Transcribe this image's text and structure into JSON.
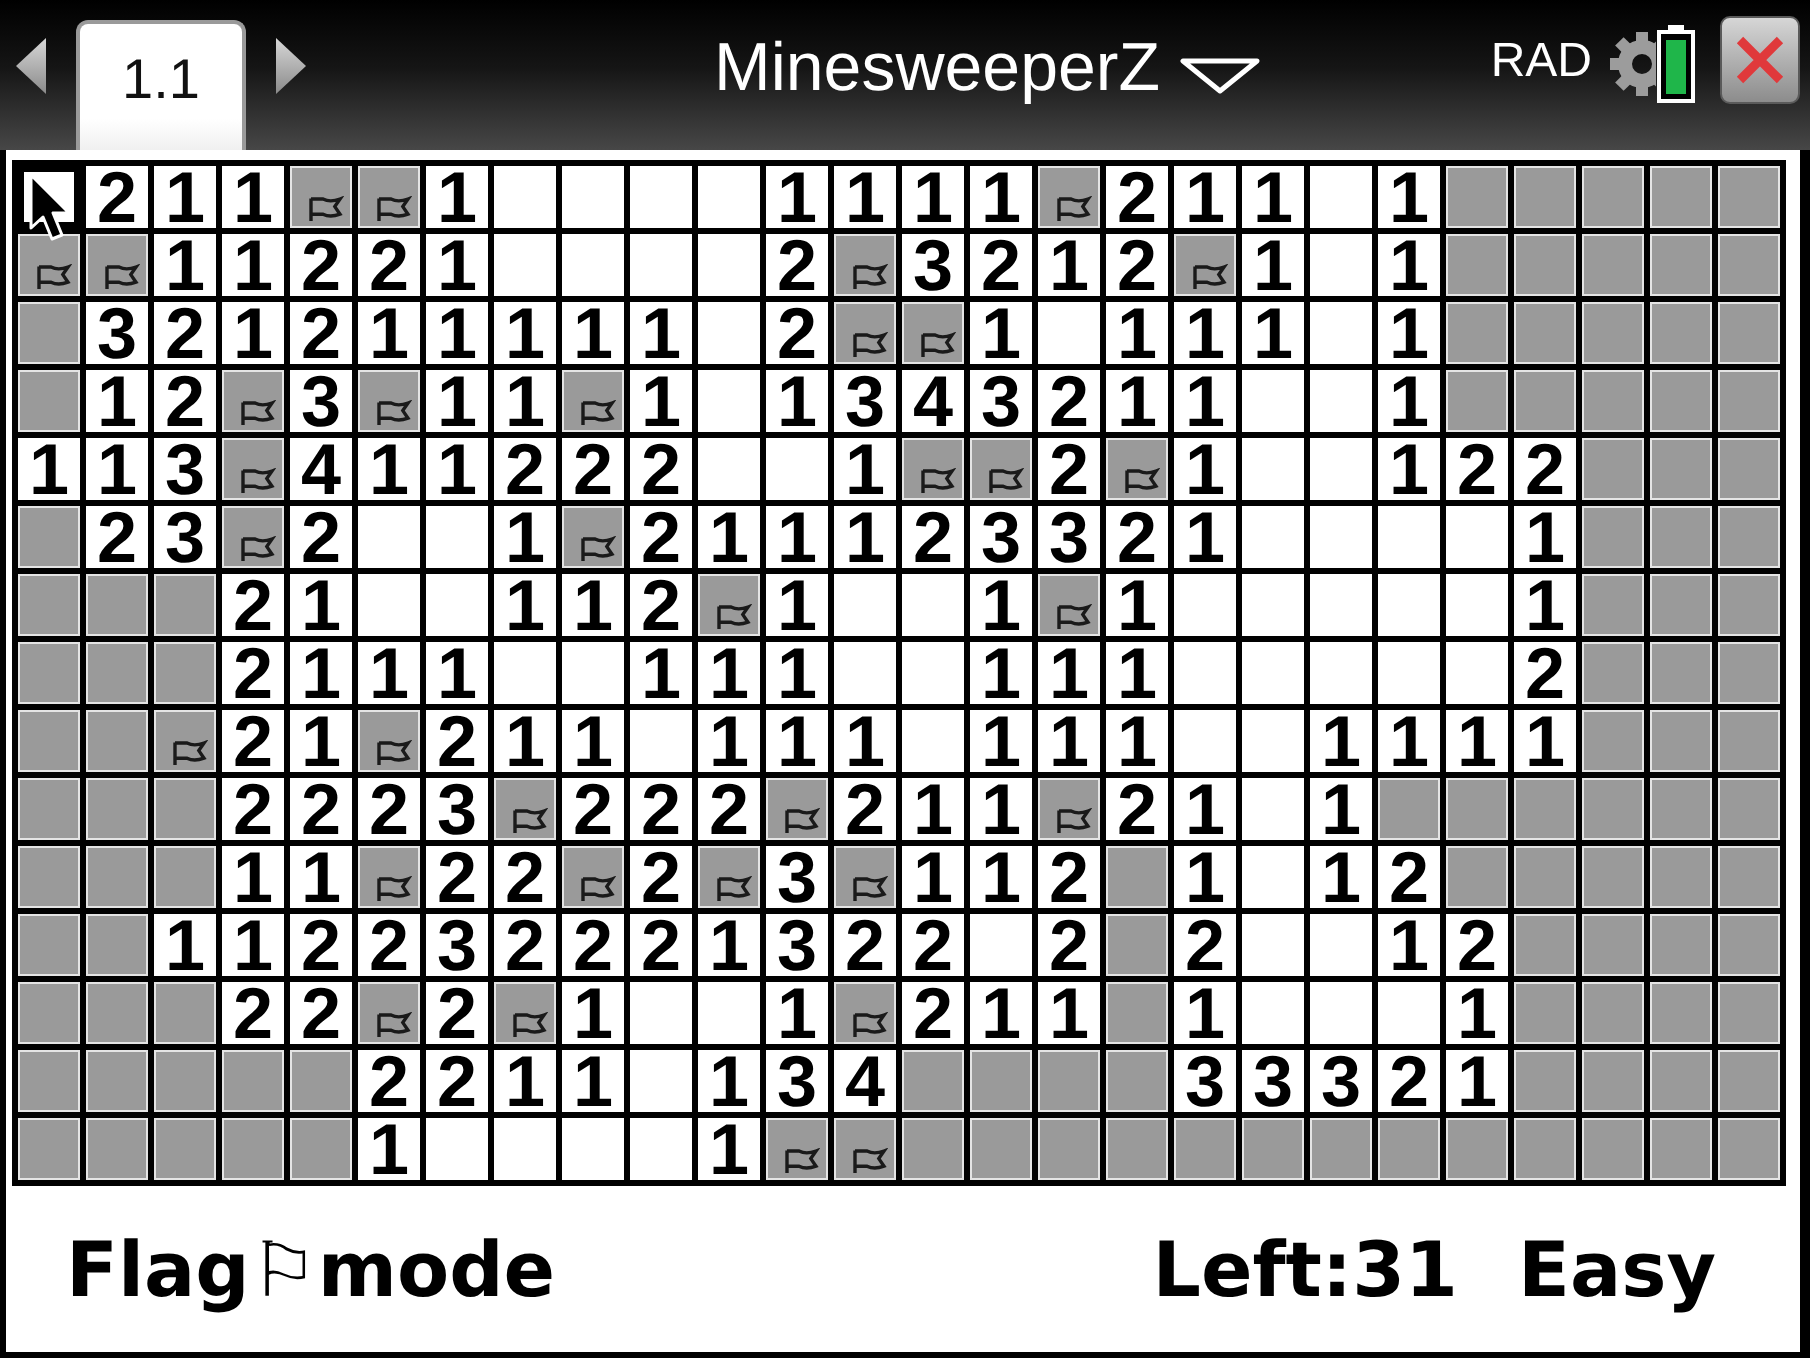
{
  "header": {
    "tab": "1.1",
    "title": "MinesweeperZ",
    "angle_mode": "RAD"
  },
  "board": {
    "rows": [
      {
        "cells": [
          {
            "kind": "empty",
            "selected": true
          },
          {
            "kind": "number",
            "text": "2",
            "selected": false
          },
          {
            "kind": "number",
            "text": "1",
            "selected": false
          },
          {
            "kind": "number",
            "text": "1",
            "selected": false
          },
          {
            "kind": "flag",
            "selected": false
          },
          {
            "kind": "flag",
            "selected": false
          },
          {
            "kind": "number",
            "text": "1",
            "selected": false
          },
          {
            "kind": "empty",
            "selected": false
          },
          {
            "kind": "empty",
            "selected": false
          },
          {
            "kind": "empty",
            "selected": false
          },
          {
            "kind": "empty",
            "selected": false
          },
          {
            "kind": "number",
            "text": "1",
            "selected": false
          },
          {
            "kind": "number",
            "text": "1",
            "selected": false
          },
          {
            "kind": "number",
            "text": "1",
            "selected": false
          },
          {
            "kind": "number",
            "text": "1",
            "selected": false
          },
          {
            "kind": "flag",
            "selected": false
          },
          {
            "kind": "number",
            "text": "2",
            "selected": false
          },
          {
            "kind": "number",
            "text": "1",
            "selected": false
          },
          {
            "kind": "number",
            "text": "1",
            "selected": false
          },
          {
            "kind": "empty",
            "selected": false
          },
          {
            "kind": "number",
            "text": "1",
            "selected": false
          },
          {
            "kind": "hidden",
            "selected": false
          },
          {
            "kind": "hidden",
            "selected": false
          },
          {
            "kind": "hidden",
            "selected": false
          },
          {
            "kind": "hidden",
            "selected": false
          },
          {
            "kind": "hidden",
            "selected": false
          }
        ]
      },
      {
        "cells": [
          {
            "kind": "flag",
            "selected": false
          },
          {
            "kind": "flag",
            "selected": false
          },
          {
            "kind": "number",
            "text": "1",
            "selected": false
          },
          {
            "kind": "number",
            "text": "1",
            "selected": false
          },
          {
            "kind": "number",
            "text": "2",
            "selected": false
          },
          {
            "kind": "number",
            "text": "2",
            "selected": false
          },
          {
            "kind": "number",
            "text": "1",
            "selected": false
          },
          {
            "kind": "empty",
            "selected": false
          },
          {
            "kind": "empty",
            "selected": false
          },
          {
            "kind": "empty",
            "selected": false
          },
          {
            "kind": "empty",
            "selected": false
          },
          {
            "kind": "number",
            "text": "2",
            "selected": false
          },
          {
            "kind": "flag",
            "selected": false
          },
          {
            "kind": "number",
            "text": "3",
            "selected": false
          },
          {
            "kind": "number",
            "text": "2",
            "selected": false
          },
          {
            "kind": "number",
            "text": "1",
            "selected": false
          },
          {
            "kind": "number",
            "text": "2",
            "selected": false
          },
          {
            "kind": "flag",
            "selected": false
          },
          {
            "kind": "number",
            "text": "1",
            "selected": false
          },
          {
            "kind": "empty",
            "selected": false
          },
          {
            "kind": "number",
            "text": "1",
            "selected": false
          },
          {
            "kind": "hidden",
            "selected": false
          },
          {
            "kind": "hidden",
            "selected": false
          },
          {
            "kind": "hidden",
            "selected": false
          },
          {
            "kind": "hidden",
            "selected": false
          },
          {
            "kind": "hidden",
            "selected": false
          }
        ]
      },
      {
        "cells": [
          {
            "kind": "hidden",
            "selected": false
          },
          {
            "kind": "number",
            "text": "3",
            "selected": false
          },
          {
            "kind": "number",
            "text": "2",
            "selected": false
          },
          {
            "kind": "number",
            "text": "1",
            "selected": false
          },
          {
            "kind": "number",
            "text": "2",
            "selected": false
          },
          {
            "kind": "number",
            "text": "1",
            "selected": false
          },
          {
            "kind": "number",
            "text": "1",
            "selected": false
          },
          {
            "kind": "number",
            "text": "1",
            "selected": false
          },
          {
            "kind": "number",
            "text": "1",
            "selected": false
          },
          {
            "kind": "number",
            "text": "1",
            "selected": false
          },
          {
            "kind": "empty",
            "selected": false
          },
          {
            "kind": "number",
            "text": "2",
            "selected": false
          },
          {
            "kind": "flag",
            "selected": false
          },
          {
            "kind": "flag",
            "selected": false
          },
          {
            "kind": "number",
            "text": "1",
            "selected": false
          },
          {
            "kind": "empty",
            "selected": false
          },
          {
            "kind": "number",
            "text": "1",
            "selected": false
          },
          {
            "kind": "number",
            "text": "1",
            "selected": false
          },
          {
            "kind": "number",
            "text": "1",
            "selected": false
          },
          {
            "kind": "empty",
            "selected": false
          },
          {
            "kind": "number",
            "text": "1",
            "selected": false
          },
          {
            "kind": "hidden",
            "selected": false
          },
          {
            "kind": "hidden",
            "selected": false
          },
          {
            "kind": "hidden",
            "selected": false
          },
          {
            "kind": "hidden",
            "selected": false
          },
          {
            "kind": "hidden",
            "selected": false
          }
        ]
      },
      {
        "cells": [
          {
            "kind": "hidden",
            "selected": false
          },
          {
            "kind": "number",
            "text": "1",
            "selected": false
          },
          {
            "kind": "number",
            "text": "2",
            "selected": false
          },
          {
            "kind": "flag",
            "selected": false
          },
          {
            "kind": "number",
            "text": "3",
            "selected": false
          },
          {
            "kind": "flag",
            "selected": false
          },
          {
            "kind": "number",
            "text": "1",
            "selected": false
          },
          {
            "kind": "number",
            "text": "1",
            "selected": false
          },
          {
            "kind": "flag",
            "selected": false
          },
          {
            "kind": "number",
            "text": "1",
            "selected": false
          },
          {
            "kind": "empty",
            "selected": false
          },
          {
            "kind": "number",
            "text": "1",
            "selected": false
          },
          {
            "kind": "number",
            "text": "3",
            "selected": false
          },
          {
            "kind": "number",
            "text": "4",
            "selected": false
          },
          {
            "kind": "number",
            "text": "3",
            "selected": false
          },
          {
            "kind": "number",
            "text": "2",
            "selected": false
          },
          {
            "kind": "number",
            "text": "1",
            "selected": false
          },
          {
            "kind": "number",
            "text": "1",
            "selected": false
          },
          {
            "kind": "empty",
            "selected": false
          },
          {
            "kind": "empty",
            "selected": false
          },
          {
            "kind": "number",
            "text": "1",
            "selected": false
          },
          {
            "kind": "hidden",
            "selected": false
          },
          {
            "kind": "hidden",
            "selected": false
          },
          {
            "kind": "hidden",
            "selected": false
          },
          {
            "kind": "hidden",
            "selected": false
          },
          {
            "kind": "hidden",
            "selected": false
          }
        ]
      },
      {
        "cells": [
          {
            "kind": "number",
            "text": "1",
            "selected": false
          },
          {
            "kind": "number",
            "text": "1",
            "selected": false
          },
          {
            "kind": "number",
            "text": "3",
            "selected": false
          },
          {
            "kind": "flag",
            "selected": false
          },
          {
            "kind": "number",
            "text": "4",
            "selected": false
          },
          {
            "kind": "number",
            "text": "1",
            "selected": false
          },
          {
            "kind": "number",
            "text": "1",
            "selected": false
          },
          {
            "kind": "number",
            "text": "2",
            "selected": false
          },
          {
            "kind": "number",
            "text": "2",
            "selected": false
          },
          {
            "kind": "number",
            "text": "2",
            "selected": false
          },
          {
            "kind": "empty",
            "selected": false
          },
          {
            "kind": "empty",
            "selected": false
          },
          {
            "kind": "number",
            "text": "1",
            "selected": false
          },
          {
            "kind": "flag",
            "selected": false
          },
          {
            "kind": "flag",
            "selected": false
          },
          {
            "kind": "number",
            "text": "2",
            "selected": false
          },
          {
            "kind": "flag",
            "selected": false
          },
          {
            "kind": "number",
            "text": "1",
            "selected": false
          },
          {
            "kind": "empty",
            "selected": false
          },
          {
            "kind": "empty",
            "selected": false
          },
          {
            "kind": "number",
            "text": "1",
            "selected": false
          },
          {
            "kind": "number",
            "text": "2",
            "selected": false
          },
          {
            "kind": "number",
            "text": "2",
            "selected": false
          },
          {
            "kind": "hidden",
            "selected": false
          },
          {
            "kind": "hidden",
            "selected": false
          },
          {
            "kind": "hidden",
            "selected": false
          }
        ]
      },
      {
        "cells": [
          {
            "kind": "hidden",
            "selected": false
          },
          {
            "kind": "number",
            "text": "2",
            "selected": false
          },
          {
            "kind": "number",
            "text": "3",
            "selected": false
          },
          {
            "kind": "flag",
            "selected": false
          },
          {
            "kind": "number",
            "text": "2",
            "selected": false
          },
          {
            "kind": "empty",
            "selected": false
          },
          {
            "kind": "empty",
            "selected": false
          },
          {
            "kind": "number",
            "text": "1",
            "selected": false
          },
          {
            "kind": "flag",
            "selected": false
          },
          {
            "kind": "number",
            "text": "2",
            "selected": false
          },
          {
            "kind": "number",
            "text": "1",
            "selected": false
          },
          {
            "kind": "number",
            "text": "1",
            "selected": false
          },
          {
            "kind": "number",
            "text": "1",
            "selected": false
          },
          {
            "kind": "number",
            "text": "2",
            "selected": false
          },
          {
            "kind": "number",
            "text": "3",
            "selected": false
          },
          {
            "kind": "number",
            "text": "3",
            "selected": false
          },
          {
            "kind": "number",
            "text": "2",
            "selected": false
          },
          {
            "kind": "number",
            "text": "1",
            "selected": false
          },
          {
            "kind": "empty",
            "selected": false
          },
          {
            "kind": "empty",
            "selected": false
          },
          {
            "kind": "empty",
            "selected": false
          },
          {
            "kind": "empty",
            "selected": false
          },
          {
            "kind": "number",
            "text": "1",
            "selected": false
          },
          {
            "kind": "hidden",
            "selected": false
          },
          {
            "kind": "hidden",
            "selected": false
          },
          {
            "kind": "hidden",
            "selected": false
          }
        ]
      },
      {
        "cells": [
          {
            "kind": "hidden",
            "selected": false
          },
          {
            "kind": "hidden",
            "selected": false
          },
          {
            "kind": "hidden",
            "selected": false
          },
          {
            "kind": "number",
            "text": "2",
            "selected": false
          },
          {
            "kind": "number",
            "text": "1",
            "selected": false
          },
          {
            "kind": "empty",
            "selected": false
          },
          {
            "kind": "empty",
            "selected": false
          },
          {
            "kind": "number",
            "text": "1",
            "selected": false
          },
          {
            "kind": "number",
            "text": "1",
            "selected": false
          },
          {
            "kind": "number",
            "text": "2",
            "selected": false
          },
          {
            "kind": "flag",
            "selected": false
          },
          {
            "kind": "number",
            "text": "1",
            "selected": false
          },
          {
            "kind": "empty",
            "selected": false
          },
          {
            "kind": "empty",
            "selected": false
          },
          {
            "kind": "number",
            "text": "1",
            "selected": false
          },
          {
            "kind": "flag",
            "selected": false
          },
          {
            "kind": "number",
            "text": "1",
            "selected": false
          },
          {
            "kind": "empty",
            "selected": false
          },
          {
            "kind": "empty",
            "selected": false
          },
          {
            "kind": "empty",
            "selected": false
          },
          {
            "kind": "empty",
            "selected": false
          },
          {
            "kind": "empty",
            "selected": false
          },
          {
            "kind": "number",
            "text": "1",
            "selected": false
          },
          {
            "kind": "hidden",
            "selected": false
          },
          {
            "kind": "hidden",
            "selected": false
          },
          {
            "kind": "hidden",
            "selected": false
          }
        ]
      },
      {
        "cells": [
          {
            "kind": "hidden",
            "selected": false
          },
          {
            "kind": "hidden",
            "selected": false
          },
          {
            "kind": "hidden",
            "selected": false
          },
          {
            "kind": "number",
            "text": "2",
            "selected": false
          },
          {
            "kind": "number",
            "text": "1",
            "selected": false
          },
          {
            "kind": "number",
            "text": "1",
            "selected": false
          },
          {
            "kind": "number",
            "text": "1",
            "selected": false
          },
          {
            "kind": "empty",
            "selected": false
          },
          {
            "kind": "empty",
            "selected": false
          },
          {
            "kind": "number",
            "text": "1",
            "selected": false
          },
          {
            "kind": "number",
            "text": "1",
            "selected": false
          },
          {
            "kind": "number",
            "text": "1",
            "selected": false
          },
          {
            "kind": "empty",
            "selected": false
          },
          {
            "kind": "empty",
            "selected": false
          },
          {
            "kind": "number",
            "text": "1",
            "selected": false
          },
          {
            "kind": "number",
            "text": "1",
            "selected": false
          },
          {
            "kind": "number",
            "text": "1",
            "selected": false
          },
          {
            "kind": "empty",
            "selected": false
          },
          {
            "kind": "empty",
            "selected": false
          },
          {
            "kind": "empty",
            "selected": false
          },
          {
            "kind": "empty",
            "selected": false
          },
          {
            "kind": "empty",
            "selected": false
          },
          {
            "kind": "number",
            "text": "2",
            "selected": false
          },
          {
            "kind": "hidden",
            "selected": false
          },
          {
            "kind": "hidden",
            "selected": false
          },
          {
            "kind": "hidden",
            "selected": false
          }
        ]
      },
      {
        "cells": [
          {
            "kind": "hidden",
            "selected": false
          },
          {
            "kind": "hidden",
            "selected": false
          },
          {
            "kind": "flag",
            "selected": false
          },
          {
            "kind": "number",
            "text": "2",
            "selected": false
          },
          {
            "kind": "number",
            "text": "1",
            "selected": false
          },
          {
            "kind": "flag",
            "selected": false
          },
          {
            "kind": "number",
            "text": "2",
            "selected": false
          },
          {
            "kind": "number",
            "text": "1",
            "selected": false
          },
          {
            "kind": "number",
            "text": "1",
            "selected": false
          },
          {
            "kind": "empty",
            "selected": false
          },
          {
            "kind": "number",
            "text": "1",
            "selected": false
          },
          {
            "kind": "number",
            "text": "1",
            "selected": false
          },
          {
            "kind": "number",
            "text": "1",
            "selected": false
          },
          {
            "kind": "empty",
            "selected": false
          },
          {
            "kind": "number",
            "text": "1",
            "selected": false
          },
          {
            "kind": "number",
            "text": "1",
            "selected": false
          },
          {
            "kind": "number",
            "text": "1",
            "selected": false
          },
          {
            "kind": "empty",
            "selected": false
          },
          {
            "kind": "empty",
            "selected": false
          },
          {
            "kind": "number",
            "text": "1",
            "selected": false
          },
          {
            "kind": "number",
            "text": "1",
            "selected": false
          },
          {
            "kind": "number",
            "text": "1",
            "selected": false
          },
          {
            "kind": "number",
            "text": "1",
            "selected": false
          },
          {
            "kind": "hidden",
            "selected": false
          },
          {
            "kind": "hidden",
            "selected": false
          },
          {
            "kind": "hidden",
            "selected": false
          }
        ]
      },
      {
        "cells": [
          {
            "kind": "hidden",
            "selected": false
          },
          {
            "kind": "hidden",
            "selected": false
          },
          {
            "kind": "hidden",
            "selected": false
          },
          {
            "kind": "number",
            "text": "2",
            "selected": false
          },
          {
            "kind": "number",
            "text": "2",
            "selected": false
          },
          {
            "kind": "number",
            "text": "2",
            "selected": false
          },
          {
            "kind": "number",
            "text": "3",
            "selected": false
          },
          {
            "kind": "flag",
            "selected": false
          },
          {
            "kind": "number",
            "text": "2",
            "selected": false
          },
          {
            "kind": "number",
            "text": "2",
            "selected": false
          },
          {
            "kind": "number",
            "text": "2",
            "selected": false
          },
          {
            "kind": "flag",
            "selected": false
          },
          {
            "kind": "number",
            "text": "2",
            "selected": false
          },
          {
            "kind": "number",
            "text": "1",
            "selected": false
          },
          {
            "kind": "number",
            "text": "1",
            "selected": false
          },
          {
            "kind": "flag",
            "selected": false
          },
          {
            "kind": "number",
            "text": "2",
            "selected": false
          },
          {
            "kind": "number",
            "text": "1",
            "selected": false
          },
          {
            "kind": "empty",
            "selected": false
          },
          {
            "kind": "number",
            "text": "1",
            "selected": false
          },
          {
            "kind": "hidden",
            "selected": false
          },
          {
            "kind": "hidden",
            "selected": false
          },
          {
            "kind": "hidden",
            "selected": false
          },
          {
            "kind": "hidden",
            "selected": false
          },
          {
            "kind": "hidden",
            "selected": false
          },
          {
            "kind": "hidden",
            "selected": false
          }
        ]
      },
      {
        "cells": [
          {
            "kind": "hidden",
            "selected": false
          },
          {
            "kind": "hidden",
            "selected": false
          },
          {
            "kind": "hidden",
            "selected": false
          },
          {
            "kind": "number",
            "text": "1",
            "selected": false
          },
          {
            "kind": "number",
            "text": "1",
            "selected": false
          },
          {
            "kind": "flag",
            "selected": false
          },
          {
            "kind": "number",
            "text": "2",
            "selected": false
          },
          {
            "kind": "number",
            "text": "2",
            "selected": false
          },
          {
            "kind": "flag",
            "selected": false
          },
          {
            "kind": "number",
            "text": "2",
            "selected": false
          },
          {
            "kind": "flag",
            "selected": false
          },
          {
            "kind": "number",
            "text": "3",
            "selected": false
          },
          {
            "kind": "flag",
            "selected": false
          },
          {
            "kind": "number",
            "text": "1",
            "selected": false
          },
          {
            "kind": "number",
            "text": "1",
            "selected": false
          },
          {
            "kind": "number",
            "text": "2",
            "selected": false
          },
          {
            "kind": "hidden",
            "selected": false
          },
          {
            "kind": "number",
            "text": "1",
            "selected": false
          },
          {
            "kind": "empty",
            "selected": false
          },
          {
            "kind": "number",
            "text": "1",
            "selected": false
          },
          {
            "kind": "number",
            "text": "2",
            "selected": false
          },
          {
            "kind": "hidden",
            "selected": false
          },
          {
            "kind": "hidden",
            "selected": false
          },
          {
            "kind": "hidden",
            "selected": false
          },
          {
            "kind": "hidden",
            "selected": false
          },
          {
            "kind": "hidden",
            "selected": false
          }
        ]
      },
      {
        "cells": [
          {
            "kind": "hidden",
            "selected": false
          },
          {
            "kind": "hidden",
            "selected": false
          },
          {
            "kind": "number",
            "text": "1",
            "selected": false
          },
          {
            "kind": "number",
            "text": "1",
            "selected": false
          },
          {
            "kind": "number",
            "text": "2",
            "selected": false
          },
          {
            "kind": "number",
            "text": "2",
            "selected": false
          },
          {
            "kind": "number",
            "text": "3",
            "selected": false
          },
          {
            "kind": "number",
            "text": "2",
            "selected": false
          },
          {
            "kind": "number",
            "text": "2",
            "selected": false
          },
          {
            "kind": "number",
            "text": "2",
            "selected": false
          },
          {
            "kind": "number",
            "text": "1",
            "selected": false
          },
          {
            "kind": "number",
            "text": "3",
            "selected": false
          },
          {
            "kind": "number",
            "text": "2",
            "selected": false
          },
          {
            "kind": "number",
            "text": "2",
            "selected": false
          },
          {
            "kind": "empty",
            "selected": false
          },
          {
            "kind": "number",
            "text": "2",
            "selected": false
          },
          {
            "kind": "hidden",
            "selected": false
          },
          {
            "kind": "number",
            "text": "2",
            "selected": false
          },
          {
            "kind": "empty",
            "selected": false
          },
          {
            "kind": "empty",
            "selected": false
          },
          {
            "kind": "number",
            "text": "1",
            "selected": false
          },
          {
            "kind": "number",
            "text": "2",
            "selected": false
          },
          {
            "kind": "hidden",
            "selected": false
          },
          {
            "kind": "hidden",
            "selected": false
          },
          {
            "kind": "hidden",
            "selected": false
          },
          {
            "kind": "hidden",
            "selected": false
          }
        ]
      },
      {
        "cells": [
          {
            "kind": "hidden",
            "selected": false
          },
          {
            "kind": "hidden",
            "selected": false
          },
          {
            "kind": "hidden",
            "selected": false
          },
          {
            "kind": "number",
            "text": "2",
            "selected": false
          },
          {
            "kind": "number",
            "text": "2",
            "selected": false
          },
          {
            "kind": "flag",
            "selected": false
          },
          {
            "kind": "number",
            "text": "2",
            "selected": false
          },
          {
            "kind": "flag",
            "selected": false
          },
          {
            "kind": "number",
            "text": "1",
            "selected": false
          },
          {
            "kind": "empty",
            "selected": false
          },
          {
            "kind": "empty",
            "selected": false
          },
          {
            "kind": "number",
            "text": "1",
            "selected": false
          },
          {
            "kind": "flag",
            "selected": false
          },
          {
            "kind": "number",
            "text": "2",
            "selected": false
          },
          {
            "kind": "number",
            "text": "1",
            "selected": false
          },
          {
            "kind": "number",
            "text": "1",
            "selected": false
          },
          {
            "kind": "hidden",
            "selected": false
          },
          {
            "kind": "number",
            "text": "1",
            "selected": false
          },
          {
            "kind": "empty",
            "selected": false
          },
          {
            "kind": "empty",
            "selected": false
          },
          {
            "kind": "empty",
            "selected": false
          },
          {
            "kind": "number",
            "text": "1",
            "selected": false
          },
          {
            "kind": "hidden",
            "selected": false
          },
          {
            "kind": "hidden",
            "selected": false
          },
          {
            "kind": "hidden",
            "selected": false
          },
          {
            "kind": "hidden",
            "selected": false
          }
        ]
      },
      {
        "cells": [
          {
            "kind": "hidden",
            "selected": false
          },
          {
            "kind": "hidden",
            "selected": false
          },
          {
            "kind": "hidden",
            "selected": false
          },
          {
            "kind": "hidden",
            "selected": false
          },
          {
            "kind": "hidden",
            "selected": false
          },
          {
            "kind": "number",
            "text": "2",
            "selected": false
          },
          {
            "kind": "number",
            "text": "2",
            "selected": false
          },
          {
            "kind": "number",
            "text": "1",
            "selected": false
          },
          {
            "kind": "number",
            "text": "1",
            "selected": false
          },
          {
            "kind": "empty",
            "selected": false
          },
          {
            "kind": "number",
            "text": "1",
            "selected": false
          },
          {
            "kind": "number",
            "text": "3",
            "selected": false
          },
          {
            "kind": "number",
            "text": "4",
            "selected": false
          },
          {
            "kind": "hidden",
            "selected": false
          },
          {
            "kind": "hidden",
            "selected": false
          },
          {
            "kind": "hidden",
            "selected": false
          },
          {
            "kind": "hidden",
            "selected": false
          },
          {
            "kind": "number",
            "text": "3",
            "selected": false
          },
          {
            "kind": "number",
            "text": "3",
            "selected": false
          },
          {
            "kind": "number",
            "text": "3",
            "selected": false
          },
          {
            "kind": "number",
            "text": "2",
            "selected": false
          },
          {
            "kind": "number",
            "text": "1",
            "selected": false
          },
          {
            "kind": "hidden",
            "selected": false
          },
          {
            "kind": "hidden",
            "selected": false
          },
          {
            "kind": "hidden",
            "selected": false
          },
          {
            "kind": "hidden",
            "selected": false
          }
        ]
      },
      {
        "cells": [
          {
            "kind": "hidden",
            "selected": false
          },
          {
            "kind": "hidden",
            "selected": false
          },
          {
            "kind": "hidden",
            "selected": false
          },
          {
            "kind": "hidden",
            "selected": false
          },
          {
            "kind": "hidden",
            "selected": false
          },
          {
            "kind": "number",
            "text": "1",
            "selected": false
          },
          {
            "kind": "empty",
            "selected": false
          },
          {
            "kind": "empty",
            "selected": false
          },
          {
            "kind": "empty",
            "selected": false
          },
          {
            "kind": "empty",
            "selected": false
          },
          {
            "kind": "number",
            "text": "1",
            "selected": false
          },
          {
            "kind": "flag",
            "selected": false
          },
          {
            "kind": "flag",
            "selected": false
          },
          {
            "kind": "hidden",
            "selected": false
          },
          {
            "kind": "hidden",
            "selected": false
          },
          {
            "kind": "hidden",
            "selected": false
          },
          {
            "kind": "hidden",
            "selected": false
          },
          {
            "kind": "hidden",
            "selected": false
          },
          {
            "kind": "hidden",
            "selected": false
          },
          {
            "kind": "hidden",
            "selected": false
          },
          {
            "kind": "hidden",
            "selected": false
          },
          {
            "kind": "hidden",
            "selected": false
          },
          {
            "kind": "hidden",
            "selected": false
          },
          {
            "kind": "hidden",
            "selected": false
          },
          {
            "kind": "hidden",
            "selected": false
          },
          {
            "kind": "hidden",
            "selected": false
          }
        ]
      }
    ]
  },
  "footer": {
    "mode": "Flag⚐mode",
    "mines_left": "Left:31",
    "difficulty": "Easy"
  }
}
